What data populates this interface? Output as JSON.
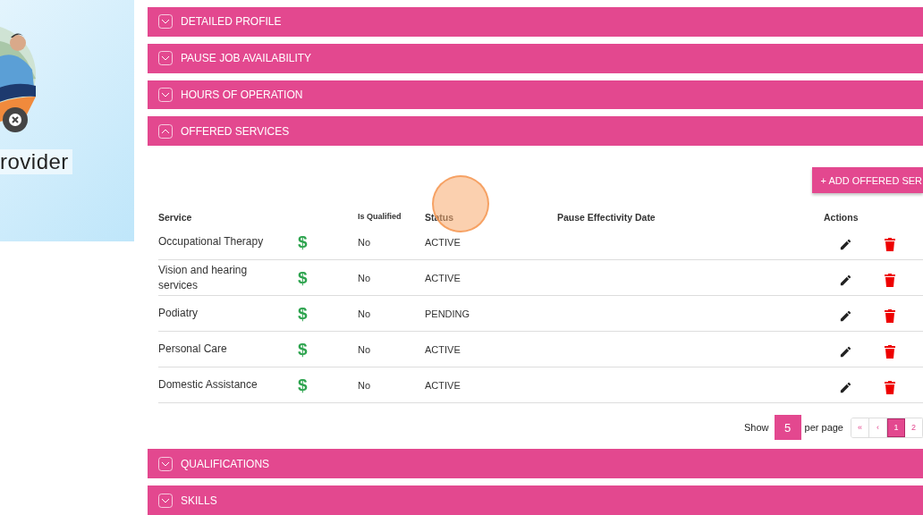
{
  "profile": {
    "name": "rovider"
  },
  "sections": [
    {
      "title": "DETAILED PROFILE",
      "expanded": false
    },
    {
      "title": "PAUSE JOB AVAILABILITY",
      "expanded": false
    },
    {
      "title": "HOURS OF OPERATION",
      "expanded": false
    },
    {
      "title": "OFFERED SERVICES",
      "expanded": true
    },
    {
      "title": "QUALIFICATIONS",
      "expanded": false
    },
    {
      "title": "SKILLS",
      "expanded": false
    }
  ],
  "offered_services": {
    "add_button": "+ ADD OFFERED SER",
    "columns": [
      "Service",
      "Is Qualified",
      "Status",
      "Pause Effectivity Date",
      "Actions"
    ],
    "rows": [
      {
        "service": "Occupational Therapy",
        "price_icon": "$",
        "is_qualified": "No",
        "status": "ACTIVE"
      },
      {
        "service": "Vision and hearing services",
        "price_icon": "$",
        "is_qualified": "No",
        "status": "ACTIVE"
      },
      {
        "service": "Podiatry",
        "price_icon": "$",
        "is_qualified": "No",
        "status": "PENDING"
      },
      {
        "service": "Personal Care",
        "price_icon": "$",
        "is_qualified": "No",
        "status": "ACTIVE"
      },
      {
        "service": "Domestic Assistance",
        "price_icon": "$",
        "is_qualified": "No",
        "status": "ACTIVE"
      }
    ],
    "pagination": {
      "show_label": "Show",
      "page_size": "5",
      "per_page_label": "per page",
      "pages": [
        {
          "label": "«",
          "selected": false
        },
        {
          "label": "‹",
          "selected": false
        },
        {
          "label": "1",
          "selected": true
        },
        {
          "label": "2",
          "selected": false
        }
      ]
    }
  }
}
